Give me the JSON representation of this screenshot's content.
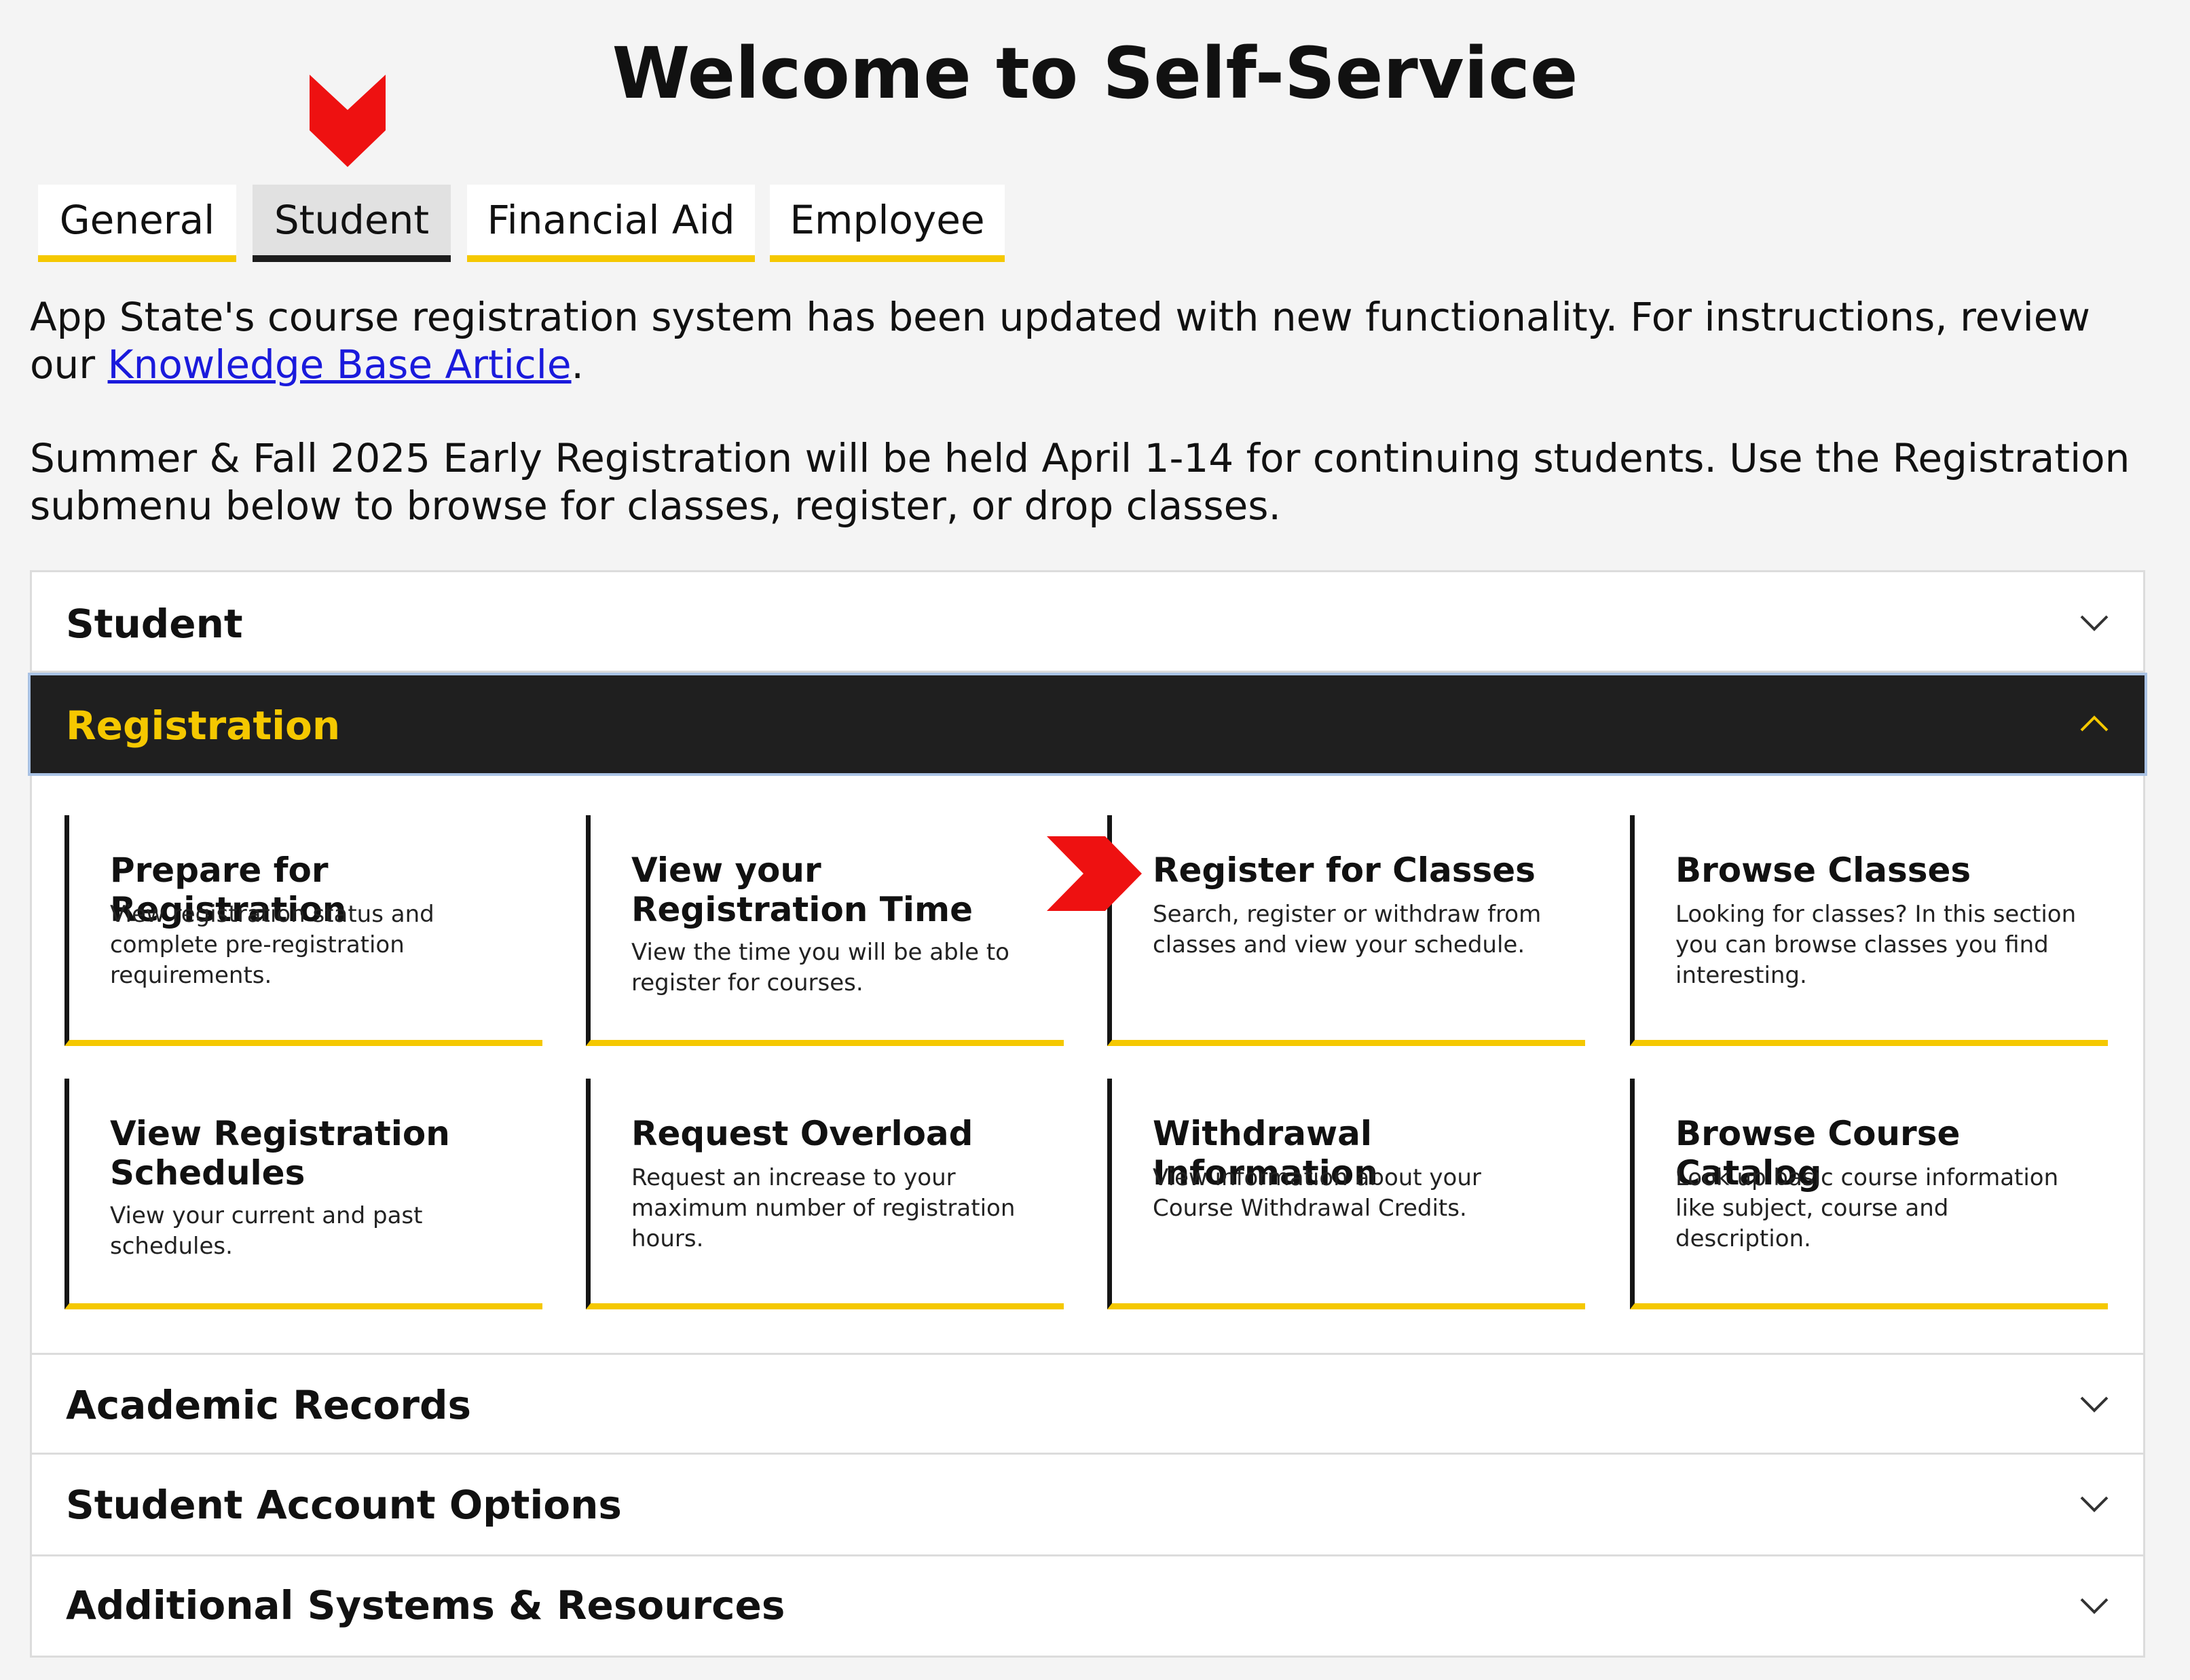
{
  "page": {
    "title": "Welcome to Self-Service"
  },
  "tabs": [
    {
      "label": "General",
      "active": false
    },
    {
      "label": "Student",
      "active": true
    },
    {
      "label": "Financial Aid",
      "active": false
    },
    {
      "label": "Employee",
      "active": false
    }
  ],
  "notice": {
    "line1_text": "App State's course registration system has been updated with new functionality. For instructions, review our ",
    "line1_link": "Knowledge Base Article",
    "line1_end": ".",
    "line2_text": "Summer & Fall 2025 Early Registration will be held April 1-14 for continuing students. Use the Registration submenu below to browse for classes, register, or drop classes."
  },
  "accordion": {
    "sections": [
      {
        "label": "Student",
        "expanded": false
      },
      {
        "label": "Registration",
        "expanded": true
      },
      {
        "label": "Academic Records",
        "expanded": false
      },
      {
        "label": "Student Account Options",
        "expanded": false
      },
      {
        "label": "Additional Systems & Resources",
        "expanded": false
      }
    ],
    "registration_tiles": [
      {
        "title": "Prepare for Registration",
        "desc": "View registration status and complete pre-registration requirements."
      },
      {
        "title": "View your Registration Time",
        "desc": "View the time you will be able to register for courses."
      },
      {
        "title": "Register for Classes",
        "desc": "Search, register or withdraw from classes and view your schedule."
      },
      {
        "title": "Browse Classes",
        "desc": "Looking for classes? In this section you can browse classes you find interesting."
      },
      {
        "title": "View Registration Schedules",
        "desc": "View your current and past schedules."
      },
      {
        "title": "Request Overload",
        "desc": "Request an increase to your maximum number of registration hours."
      },
      {
        "title": "Withdrawal Information",
        "desc": "View information about your Course Withdrawal Credits."
      },
      {
        "title": "Browse Course Catalog",
        "desc": "Look up basic course information like subject, course and description."
      }
    ]
  },
  "colors": {
    "accent": "#f5c800",
    "header_dark": "#1f1f1f",
    "marker": "#ee1111",
    "link": "#1a1adc"
  },
  "icons": {
    "tab_marker": "red-down-arrow-icon",
    "tile_marker": "red-right-arrow-icon",
    "collapsed": "chevron-down-icon",
    "expanded": "chevron-up-icon"
  }
}
